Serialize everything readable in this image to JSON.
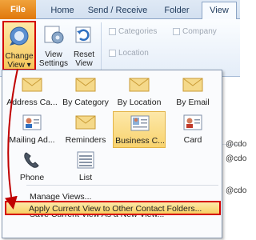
{
  "tabs": [
    "File",
    "Home",
    "Send / Receive",
    "Folder",
    "View"
  ],
  "ribbon": {
    "change_view": [
      "Change",
      "View"
    ],
    "view_settings": [
      "View",
      "Settings"
    ],
    "reset_view": [
      "Reset",
      "View"
    ],
    "categories": "Categories",
    "company": "Company",
    "location": "Location"
  },
  "views": [
    "Address Ca...",
    "By Category",
    "By Location",
    "By Email",
    "Mailing Ad...",
    "Reminders",
    "Business C...",
    "Card",
    "Phone",
    "List"
  ],
  "menu": {
    "manage_views": "Manage Views...",
    "save_view": "Save Current View As a New View...",
    "apply_view": "Apply Current View to Other Contact Folders..."
  },
  "background_text": [
    "@cdo",
    "@cdo",
    "@cdo"
  ],
  "colors": {
    "highlight_border": "#d40000",
    "file_tab": "#e0780c",
    "selected_fill": "#f8d36e"
  }
}
